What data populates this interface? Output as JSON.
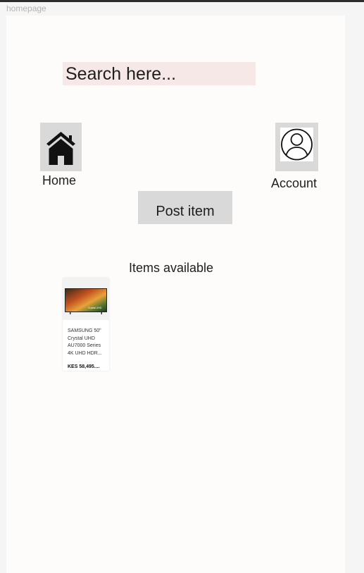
{
  "frame": {
    "label": "homepage"
  },
  "search": {
    "placeholder": "Search here..."
  },
  "nav": {
    "home": {
      "label": "Home",
      "icon": "home-icon"
    },
    "account": {
      "label": "Account",
      "icon": "user-circle-icon"
    }
  },
  "actions": {
    "post_item_label": "Post item"
  },
  "items": {
    "heading": "Items available",
    "list": [
      {
        "name": "SAMSUNG 50\" Crystal UHD AU7000 Series 4K UHD HDR...",
        "price": "KES 58,495....",
        "image_label": "Crystal UHD"
      }
    ]
  },
  "colors": {
    "search_bg": "#f7e8e8",
    "icon_box_bg": "#d9d9d9",
    "frame_bg": "#fdfcfb",
    "canvas_bg": "#f5f5f5"
  }
}
